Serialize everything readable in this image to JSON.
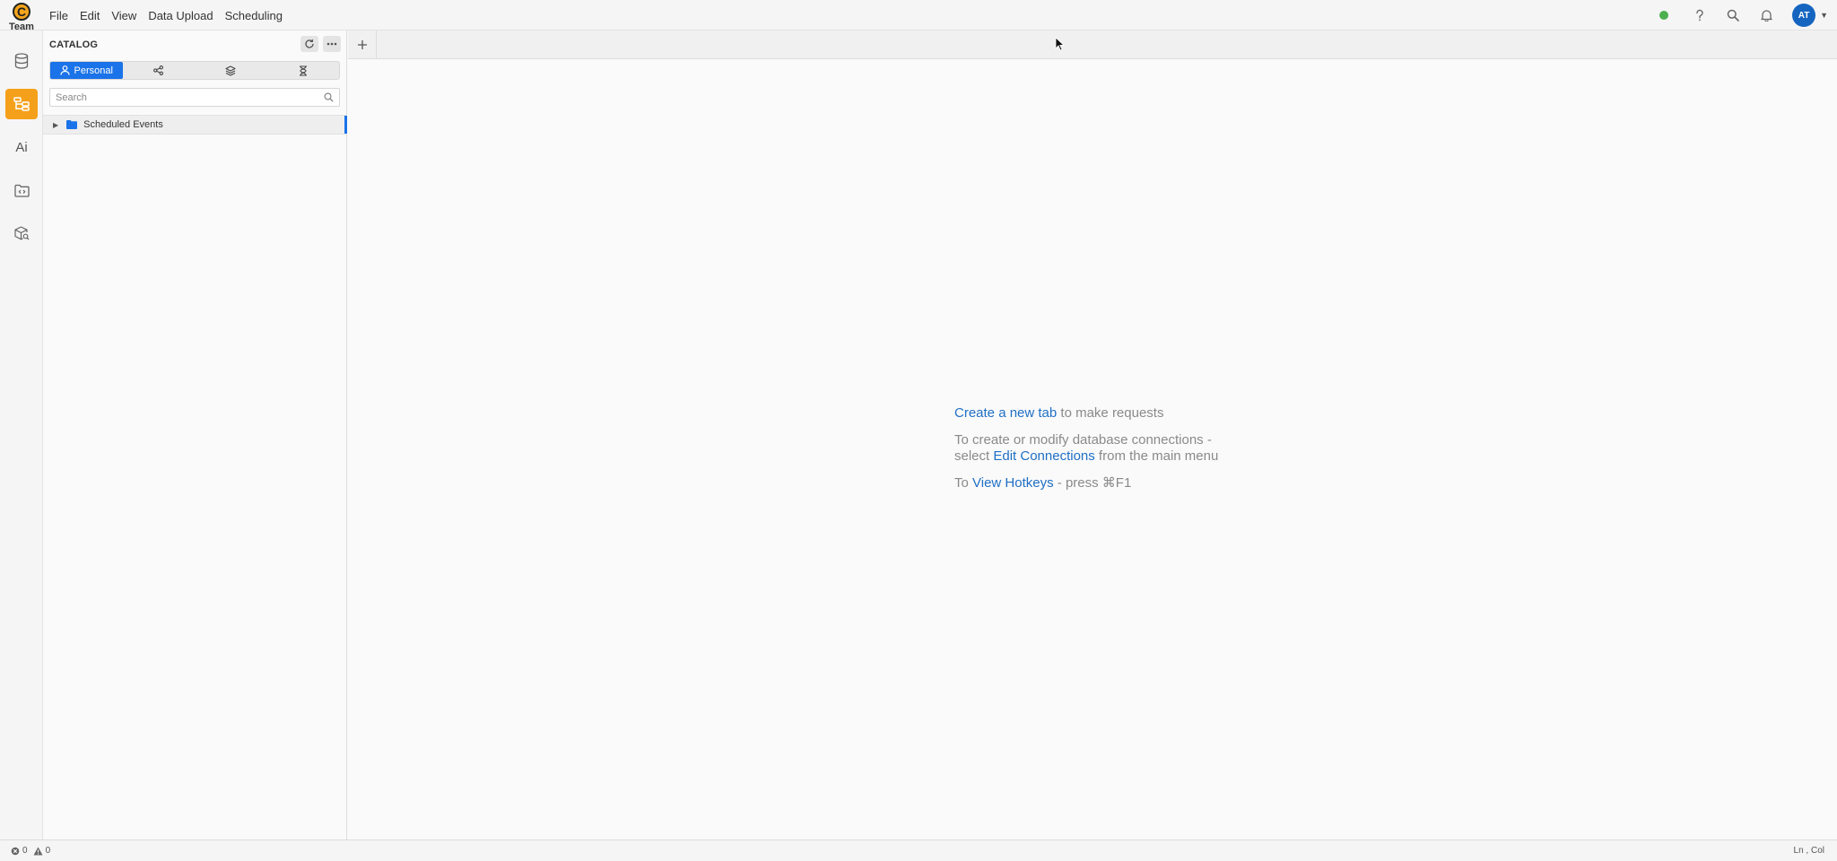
{
  "app": {
    "logo_letter": "C",
    "team_label": "Team"
  },
  "menu": [
    "File",
    "Edit",
    "View",
    "Data Upload",
    "Scheduling"
  ],
  "topbar": {
    "status_color": "#4caf50",
    "avatar_initials": "AT",
    "icons": [
      "help-icon",
      "search-icon",
      "bell-icon"
    ]
  },
  "rail": {
    "active_item": "catalog",
    "ai_label": "Ai",
    "accent_color": "#f5a01a"
  },
  "catalog": {
    "title": "CATALOG",
    "tabs": [
      {
        "icon": "person-icon",
        "label": "Personal",
        "active": true
      },
      {
        "icon": "share-icon",
        "label": ""
      },
      {
        "icon": "layers-icon",
        "label": ""
      },
      {
        "icon": "hourglass-icon",
        "label": ""
      }
    ],
    "search_placeholder": "Search",
    "tree": [
      {
        "label": "Scheduled Events",
        "type": "folder",
        "expanded": false
      }
    ]
  },
  "welcome": {
    "create_link": "Create a new tab",
    "create_rest": " to make requests",
    "connections_prefix": "To create or modify database connections -",
    "connections_select": "select ",
    "connections_link": "Edit Connections",
    "connections_suffix": " from the main menu",
    "hotkeys_prefix": "To ",
    "hotkeys_link": "View Hotkeys",
    "hotkeys_suffix": " - press ⌘F1"
  },
  "statusbar": {
    "errors": "0",
    "warnings": "0",
    "position": "Ln , Col"
  }
}
